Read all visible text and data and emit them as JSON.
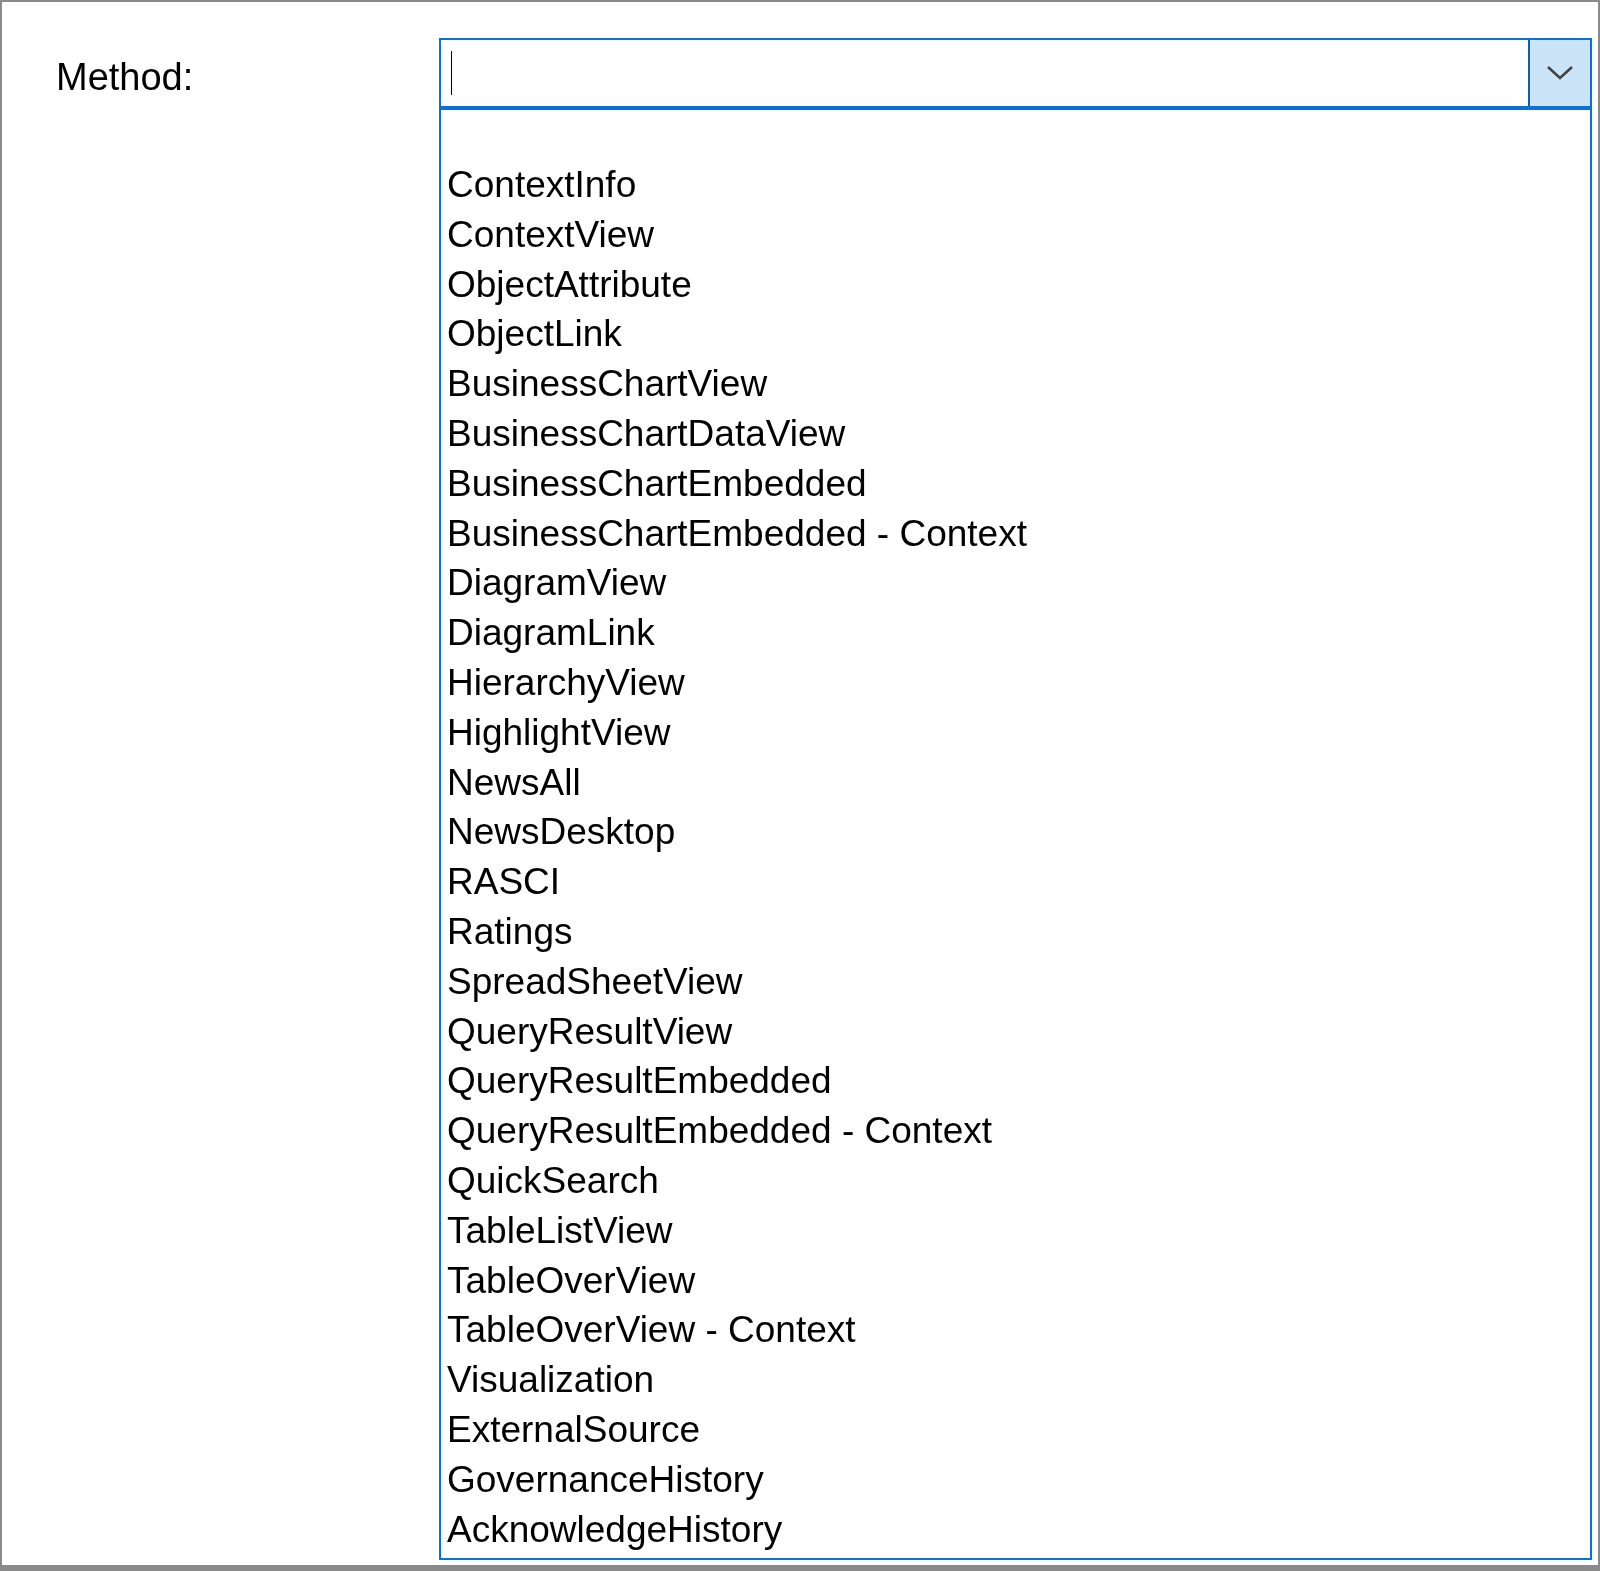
{
  "label": "Method:",
  "combo": {
    "expanded": true
  },
  "options": [
    {
      "label": "ContextInfo"
    },
    {
      "label": "ContextView"
    },
    {
      "label": "ObjectAttribute"
    },
    {
      "label": "ObjectLink"
    },
    {
      "label": "BusinessChartView"
    },
    {
      "label": "BusinessChartDataView"
    },
    {
      "label": "BusinessChartEmbedded"
    },
    {
      "label": "BusinessChartEmbedded - Context"
    },
    {
      "label": "DiagramView"
    },
    {
      "label": "DiagramLink"
    },
    {
      "label": "HierarchyView"
    },
    {
      "label": "HighlightView"
    },
    {
      "label": "NewsAll"
    },
    {
      "label": "NewsDesktop"
    },
    {
      "label": "RASCI"
    },
    {
      "label": "Ratings"
    },
    {
      "label": "SpreadSheetView"
    },
    {
      "label": "QueryResultView"
    },
    {
      "label": "QueryResultEmbedded"
    },
    {
      "label": "QueryResultEmbedded - Context"
    },
    {
      "label": "QuickSearch"
    },
    {
      "label": "TableListView"
    },
    {
      "label": "TableOverView"
    },
    {
      "label": "TableOverView - Context"
    },
    {
      "label": "Visualization"
    },
    {
      "label": "ExternalSource"
    },
    {
      "label": "GovernanceHistory"
    },
    {
      "label": "AcknowledgeHistory"
    }
  ]
}
